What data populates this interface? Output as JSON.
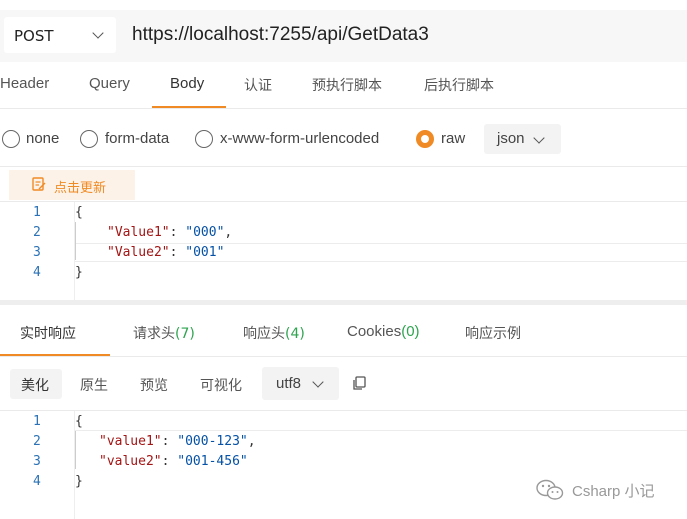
{
  "request": {
    "method": "POST",
    "url": "https://localhost:7255/api/GetData3",
    "tabs": [
      "Header",
      "Query",
      "Body",
      "认证",
      "预执行脚本",
      "后执行脚本"
    ],
    "active_tab": "Body",
    "body_types": [
      "none",
      "form-data",
      "x-www-form-urlencoded",
      "raw"
    ],
    "selected_body_type": "raw",
    "format": "json",
    "refresh_label": "点击更新",
    "line_numbers": [
      "1",
      "2",
      "3",
      "4"
    ],
    "body_lines": {
      "open": "{",
      "l2_key": "\"Value1\"",
      "l2_sep": ": ",
      "l2_val": "\"000\"",
      "l2_end": ",",
      "l3_key": "\"Value2\"",
      "l3_sep": ": ",
      "l3_val": "\"001\"",
      "close": "}"
    }
  },
  "response": {
    "tabs": {
      "realtime": "实时响应",
      "req_headers": "请求头",
      "req_headers_count": "(7)",
      "resp_headers": "响应头",
      "resp_headers_count": "(4)",
      "cookies": "Cookies",
      "cookies_count": "(0)",
      "example": "响应示例"
    },
    "view_modes": [
      "美化",
      "原生",
      "预览",
      "可视化"
    ],
    "active_view": "美化",
    "encoding": "utf8",
    "line_numbers": [
      "1",
      "2",
      "3",
      "4"
    ],
    "body_lines": {
      "open": "{",
      "l2_key": "\"value1\"",
      "l2_sep": ": ",
      "l2_val": "\"000-123\"",
      "l2_end": ",",
      "l3_key": "\"value2\"",
      "l3_sep": ": ",
      "l3_val": "\"001-456\"",
      "close": "}"
    }
  },
  "watermark": "Csharp 小记",
  "colors": {
    "accent": "#f08a24",
    "count": "#2ea44f"
  }
}
